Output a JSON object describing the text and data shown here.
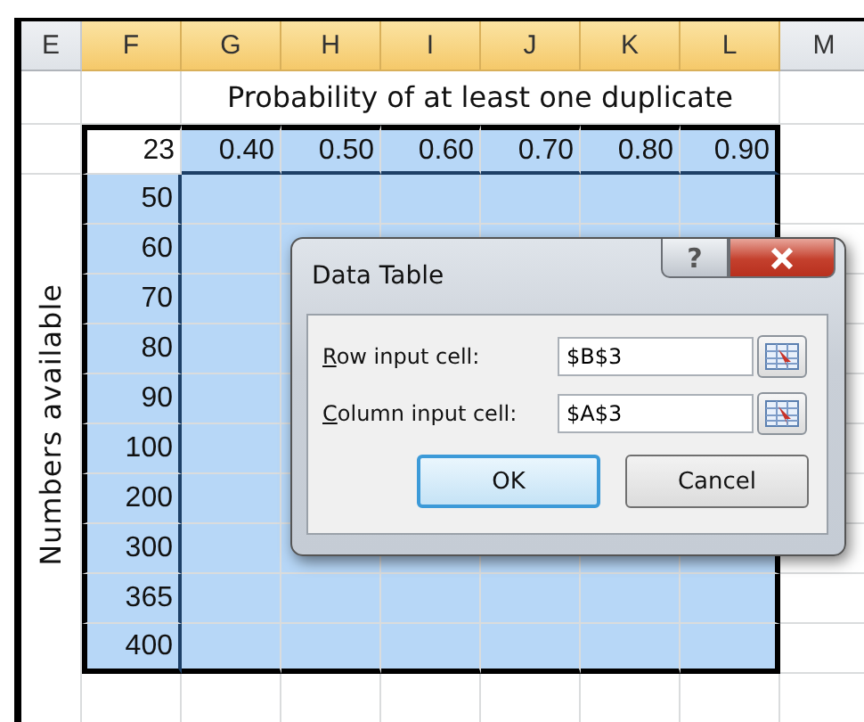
{
  "columns": [
    {
      "label": "E",
      "selected": false
    },
    {
      "label": "F",
      "selected": true
    },
    {
      "label": "G",
      "selected": true
    },
    {
      "label": "H",
      "selected": true
    },
    {
      "label": "I",
      "selected": true
    },
    {
      "label": "J",
      "selected": true
    },
    {
      "label": "K",
      "selected": true
    },
    {
      "label": "L",
      "selected": true
    },
    {
      "label": "M",
      "selected": false
    }
  ],
  "title": "Probability of at least one duplicate",
  "corner": "23",
  "probabilities": [
    "0.40",
    "0.50",
    "0.60",
    "0.70",
    "0.80",
    "0.90"
  ],
  "row_label": "Numbers available",
  "numbers": [
    "50",
    "60",
    "70",
    "80",
    "90",
    "100",
    "200",
    "300",
    "365",
    "400"
  ],
  "dialog": {
    "title": "Data Table",
    "help": "?",
    "fields": [
      {
        "label": "Row input cell:",
        "value": "$B$3"
      },
      {
        "label": "Column input cell:",
        "value": "$A$3"
      }
    ],
    "buttons": [
      {
        "label": "OK",
        "focused": true
      },
      {
        "label": "Cancel",
        "focused": false
      }
    ]
  }
}
